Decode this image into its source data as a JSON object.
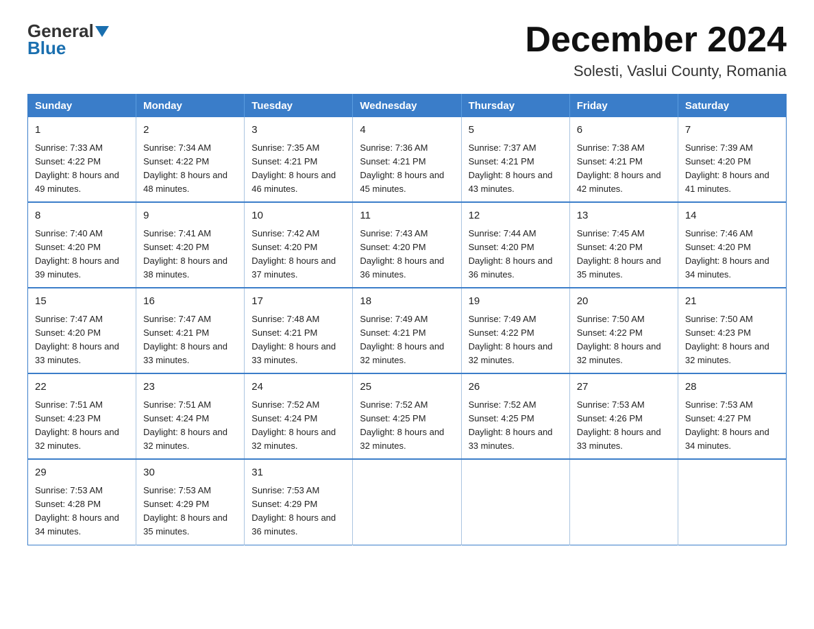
{
  "logo": {
    "general": "General",
    "blue": "Blue",
    "underline": "Blue"
  },
  "header": {
    "title": "December 2024",
    "subtitle": "Solesti, Vaslui County, Romania"
  },
  "weekdays": [
    "Sunday",
    "Monday",
    "Tuesday",
    "Wednesday",
    "Thursday",
    "Friday",
    "Saturday"
  ],
  "weeks": [
    [
      {
        "day": "1",
        "sunrise": "7:33 AM",
        "sunset": "4:22 PM",
        "daylight": "8 hours and 49 minutes."
      },
      {
        "day": "2",
        "sunrise": "7:34 AM",
        "sunset": "4:22 PM",
        "daylight": "8 hours and 48 minutes."
      },
      {
        "day": "3",
        "sunrise": "7:35 AM",
        "sunset": "4:21 PM",
        "daylight": "8 hours and 46 minutes."
      },
      {
        "day": "4",
        "sunrise": "7:36 AM",
        "sunset": "4:21 PM",
        "daylight": "8 hours and 45 minutes."
      },
      {
        "day": "5",
        "sunrise": "7:37 AM",
        "sunset": "4:21 PM",
        "daylight": "8 hours and 43 minutes."
      },
      {
        "day": "6",
        "sunrise": "7:38 AM",
        "sunset": "4:21 PM",
        "daylight": "8 hours and 42 minutes."
      },
      {
        "day": "7",
        "sunrise": "7:39 AM",
        "sunset": "4:20 PM",
        "daylight": "8 hours and 41 minutes."
      }
    ],
    [
      {
        "day": "8",
        "sunrise": "7:40 AM",
        "sunset": "4:20 PM",
        "daylight": "8 hours and 39 minutes."
      },
      {
        "day": "9",
        "sunrise": "7:41 AM",
        "sunset": "4:20 PM",
        "daylight": "8 hours and 38 minutes."
      },
      {
        "day": "10",
        "sunrise": "7:42 AM",
        "sunset": "4:20 PM",
        "daylight": "8 hours and 37 minutes."
      },
      {
        "day": "11",
        "sunrise": "7:43 AM",
        "sunset": "4:20 PM",
        "daylight": "8 hours and 36 minutes."
      },
      {
        "day": "12",
        "sunrise": "7:44 AM",
        "sunset": "4:20 PM",
        "daylight": "8 hours and 36 minutes."
      },
      {
        "day": "13",
        "sunrise": "7:45 AM",
        "sunset": "4:20 PM",
        "daylight": "8 hours and 35 minutes."
      },
      {
        "day": "14",
        "sunrise": "7:46 AM",
        "sunset": "4:20 PM",
        "daylight": "8 hours and 34 minutes."
      }
    ],
    [
      {
        "day": "15",
        "sunrise": "7:47 AM",
        "sunset": "4:20 PM",
        "daylight": "8 hours and 33 minutes."
      },
      {
        "day": "16",
        "sunrise": "7:47 AM",
        "sunset": "4:21 PM",
        "daylight": "8 hours and 33 minutes."
      },
      {
        "day": "17",
        "sunrise": "7:48 AM",
        "sunset": "4:21 PM",
        "daylight": "8 hours and 33 minutes."
      },
      {
        "day": "18",
        "sunrise": "7:49 AM",
        "sunset": "4:21 PM",
        "daylight": "8 hours and 32 minutes."
      },
      {
        "day": "19",
        "sunrise": "7:49 AM",
        "sunset": "4:22 PM",
        "daylight": "8 hours and 32 minutes."
      },
      {
        "day": "20",
        "sunrise": "7:50 AM",
        "sunset": "4:22 PM",
        "daylight": "8 hours and 32 minutes."
      },
      {
        "day": "21",
        "sunrise": "7:50 AM",
        "sunset": "4:23 PM",
        "daylight": "8 hours and 32 minutes."
      }
    ],
    [
      {
        "day": "22",
        "sunrise": "7:51 AM",
        "sunset": "4:23 PM",
        "daylight": "8 hours and 32 minutes."
      },
      {
        "day": "23",
        "sunrise": "7:51 AM",
        "sunset": "4:24 PM",
        "daylight": "8 hours and 32 minutes."
      },
      {
        "day": "24",
        "sunrise": "7:52 AM",
        "sunset": "4:24 PM",
        "daylight": "8 hours and 32 minutes."
      },
      {
        "day": "25",
        "sunrise": "7:52 AM",
        "sunset": "4:25 PM",
        "daylight": "8 hours and 32 minutes."
      },
      {
        "day": "26",
        "sunrise": "7:52 AM",
        "sunset": "4:25 PM",
        "daylight": "8 hours and 33 minutes."
      },
      {
        "day": "27",
        "sunrise": "7:53 AM",
        "sunset": "4:26 PM",
        "daylight": "8 hours and 33 minutes."
      },
      {
        "day": "28",
        "sunrise": "7:53 AM",
        "sunset": "4:27 PM",
        "daylight": "8 hours and 34 minutes."
      }
    ],
    [
      {
        "day": "29",
        "sunrise": "7:53 AM",
        "sunset": "4:28 PM",
        "daylight": "8 hours and 34 minutes."
      },
      {
        "day": "30",
        "sunrise": "7:53 AM",
        "sunset": "4:29 PM",
        "daylight": "8 hours and 35 minutes."
      },
      {
        "day": "31",
        "sunrise": "7:53 AM",
        "sunset": "4:29 PM",
        "daylight": "8 hours and 36 minutes."
      },
      null,
      null,
      null,
      null
    ]
  ]
}
